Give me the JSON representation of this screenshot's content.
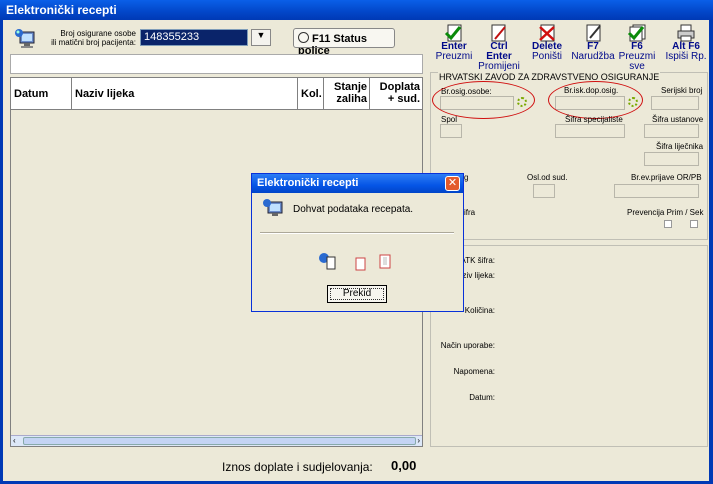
{
  "window": {
    "title": "Elektronički recepti"
  },
  "patient": {
    "label_line1": "Broj osigurane osobe",
    "label_line2": "ili matični broj pacijenta:",
    "value": "148355233",
    "f11_label": "F11 Status police"
  },
  "grid": {
    "columns": [
      {
        "label": "Datum"
      },
      {
        "label": "Naziv lijeka"
      },
      {
        "label": "Kol."
      },
      {
        "label": "Stanje zaliha"
      },
      {
        "label": "Doplata + sud."
      }
    ]
  },
  "summary": {
    "label": "Iznos doplate i sudjelovanja:",
    "value": "0,00"
  },
  "toolbar": {
    "buttons": [
      {
        "key": "Enter",
        "label": "Preuzmi"
      },
      {
        "key": "Ctrl Enter",
        "label": "Promijeni"
      },
      {
        "key": "Delete",
        "label": "Poništi"
      },
      {
        "key": "F7",
        "label": "Narudžba"
      },
      {
        "key": "F6",
        "label": "Preuzmi sve"
      },
      {
        "key": "Alt F6",
        "label": "Ispiši Rp."
      }
    ]
  },
  "hzzo": {
    "title": "HRVATSKI ZAVOD ZA ZDRAVSTVENO OSIGURANJE",
    "br_osig": "Br.osig.osobe:",
    "br_isk": "Br.isk.dop.osig.",
    "serijski": "Serijski broj",
    "spol": "Spol",
    "sifra_specijaliste": "Šifra specijaliste",
    "sifra_ustanove": "Šifra ustanove",
    "sifra_ljecnika": "Šifra liječnika",
    "osl_od_sud": "Osl.od sud.",
    "br_ev_prijave": "Br.ev.prijave OR/PB",
    "prevencija": "Prevencija Prim / Sek",
    "g_partial": "g",
    "sifra_partial": "ifra"
  },
  "lower": {
    "atk": "ATK šifra:",
    "naziv": "ziv lijeka:",
    "kolicina": "Količina:",
    "nacin": "Način uporabe:",
    "napomena": "Napomena:",
    "datum": "Datum:"
  },
  "dialog": {
    "title": "Elektronički recepti",
    "message": "Dohvat podataka recepata.",
    "button": "Prekid"
  },
  "colors": {
    "titlebar": "#0246c8",
    "selection": "#0a246a",
    "accent_red": "#d01010"
  }
}
